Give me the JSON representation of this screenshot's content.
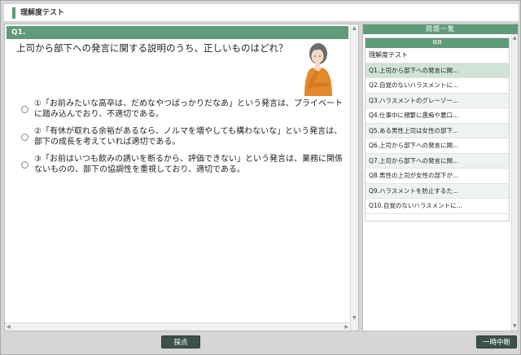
{
  "app": {
    "title": "理解度テスト"
  },
  "question": {
    "number": "Q1.",
    "text": "上司から部下への発言に関する説明のうち、正しいものはどれ？",
    "choices": [
      {
        "label": "①「お前みたいな高卒は、だめなやつばっかりだなあ」という発言は、プライベートに踏み込んでおり、不適切である。"
      },
      {
        "label": "②「有休が取れる余裕があるなら、ノルマを増やしても構わないな」という発言は、部下の成長を考えていれば適切である。"
      },
      {
        "label": "③「お前はいつも飲みの誘いを断るから、評価できない」という発言は、業務に関係ないものの、部下の協調性を重視しており、適切である。"
      }
    ]
  },
  "side": {
    "title": "問題一覧",
    "subhead": "項目",
    "items": [
      {
        "label": "理解度テスト"
      },
      {
        "label": "Q1.上司から部下への発言に関..."
      },
      {
        "label": "Q2.自覚のないハラスメントに..."
      },
      {
        "label": "Q3.ハラスメントのグレーゾー..."
      },
      {
        "label": "Q4.仕事中に頻繁に愚痴や悪口..."
      },
      {
        "label": "Q5.ある男性上司は女性の部下..."
      },
      {
        "label": "Q6.上司から部下への発言に関..."
      },
      {
        "label": "Q7.上司から部下への発言に関..."
      },
      {
        "label": "Q8.男性の上司が女性の部下が..."
      },
      {
        "label": "Q9.ハラスメントを防止するた..."
      },
      {
        "label": "Q10.自覚のないハラスメントに..."
      }
    ]
  },
  "buttons": {
    "score": "採点",
    "pause": "一時中断"
  },
  "colors": {
    "accent": "#5e9b78",
    "button": "#3b5149"
  }
}
